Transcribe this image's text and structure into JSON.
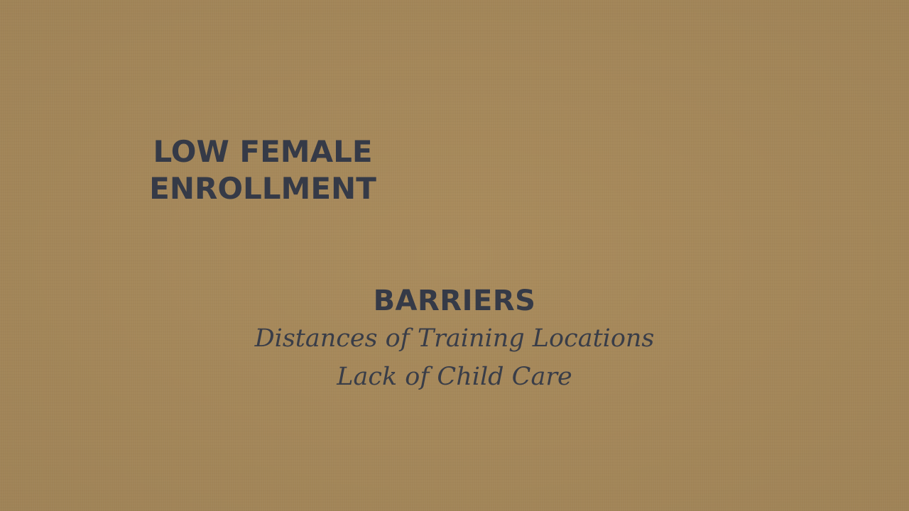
{
  "headline": {
    "line1": "LOW FEMALE",
    "line2": "ENROLLMENT"
  },
  "barriers": {
    "title": "BARRIERS",
    "items": [
      "Distances of Training Locations",
      "Lack of Child Care"
    ]
  },
  "colors": {
    "background": "#a98b5c",
    "text": "#353a47"
  }
}
